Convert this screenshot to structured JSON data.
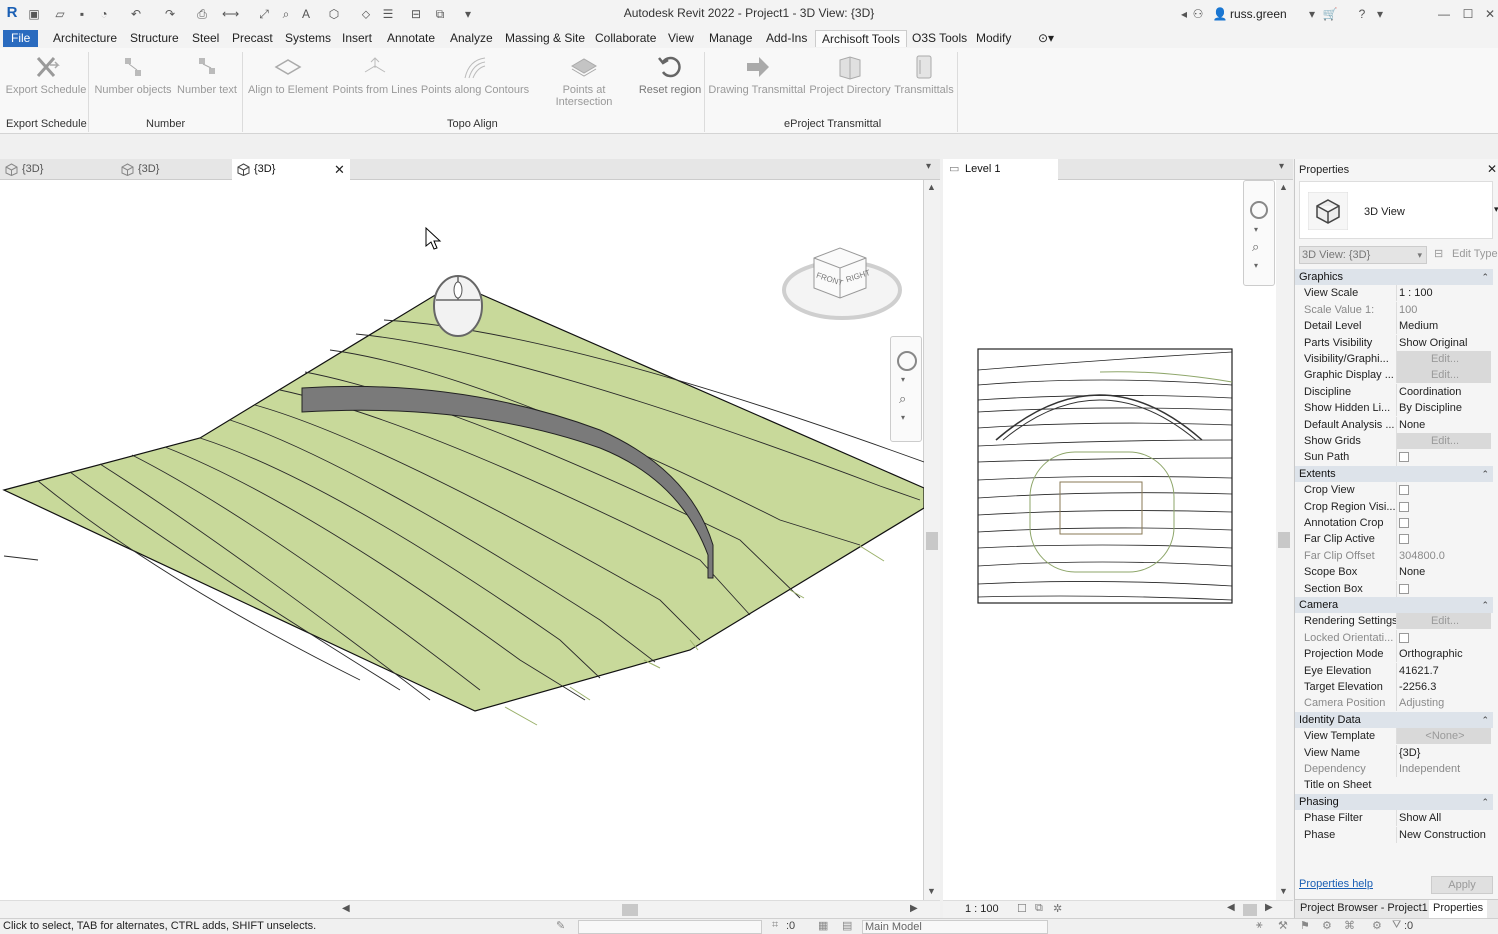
{
  "window": {
    "title": "Autodesk Revit 2022 - Project1 - 3D View: {3D}",
    "user": "russ.green"
  },
  "menu": {
    "file": "File",
    "items": [
      "Architecture",
      "Structure",
      "Steel",
      "Precast",
      "Systems",
      "Insert",
      "Annotate",
      "Analyze",
      "Massing & Site",
      "Collaborate",
      "View",
      "Manage",
      "Add-Ins",
      "Archisoft Tools",
      "O3S Tools",
      "Modify"
    ]
  },
  "ribbon": {
    "buttons": [
      "Export Schedule",
      "Number objects",
      "Number text",
      "Align to Element",
      "Points from Lines",
      "Points along Contours",
      "Points at Intersection",
      "Reset region",
      "Drawing Transmittal",
      "Project Directory",
      "Transmittals"
    ],
    "panels": [
      "Export Schedule",
      "Number",
      "Topo Align",
      "eProject Transmittal"
    ]
  },
  "tabs": {
    "t1": "{3D}",
    "t2": "{3D}",
    "t3": "{3D}",
    "level": "Level 1"
  },
  "viewcube": {
    "front": "FRONT",
    "right": "RIGHT"
  },
  "level_view": {
    "scale": "1 : 100"
  },
  "properties": {
    "title": "Properties",
    "type_name": "3D View",
    "instance_selector": "3D View: {3D}",
    "edit_type": "Edit Type",
    "graphics": {
      "label": "Graphics",
      "rows": [
        [
          "View Scale",
          "1 : 100"
        ],
        [
          "Scale Value    1:",
          "100"
        ],
        [
          "Detail Level",
          "Medium"
        ],
        [
          "Parts Visibility",
          "Show Original"
        ],
        [
          "Visibility/Graphi...",
          "Edit..."
        ],
        [
          "Graphic Display ...",
          "Edit..."
        ],
        [
          "Discipline",
          "Coordination"
        ],
        [
          "Show Hidden Li...",
          "By Discipline"
        ],
        [
          "Default Analysis ...",
          "None"
        ],
        [
          "Show Grids",
          "Edit..."
        ],
        [
          "Sun Path",
          ""
        ]
      ]
    },
    "extents": {
      "label": "Extents",
      "rows": [
        [
          "Crop View",
          ""
        ],
        [
          "Crop Region Visi...",
          ""
        ],
        [
          "Annotation Crop",
          ""
        ],
        [
          "Far Clip Active",
          ""
        ],
        [
          "Far Clip Offset",
          "304800.0"
        ],
        [
          "Scope Box",
          "None"
        ],
        [
          "Section Box",
          ""
        ]
      ]
    },
    "camera": {
      "label": "Camera",
      "rows": [
        [
          "Rendering Settings",
          "Edit..."
        ],
        [
          "Locked Orientati...",
          ""
        ],
        [
          "Projection Mode",
          "Orthographic"
        ],
        [
          "Eye Elevation",
          "41621.7"
        ],
        [
          "Target Elevation",
          "-2256.3"
        ],
        [
          "Camera Position",
          "Adjusting"
        ]
      ]
    },
    "identity": {
      "label": "Identity Data",
      "rows": [
        [
          "View Template",
          "<None>"
        ],
        [
          "View Name",
          "{3D}"
        ],
        [
          "Dependency",
          "Independent"
        ],
        [
          "Title on Sheet",
          ""
        ]
      ]
    },
    "phasing": {
      "label": "Phasing",
      "rows": [
        [
          "Phase Filter",
          "Show All"
        ],
        [
          "Phase",
          "New Construction"
        ]
      ]
    },
    "help_link": "Properties help",
    "apply": "Apply",
    "tab_browser": "Project Browser - Project1",
    "tab_props": "Properties"
  },
  "status": {
    "hint": "Click to select, TAB for alternates, CTRL adds, SHIFT unselects.",
    "zero": ":0",
    "model": "Main Model",
    "filter": ":0"
  },
  "colors": {
    "topo": "#c8d99a",
    "accent": "#2a6bbf",
    "beam": "#7a7a7a"
  }
}
